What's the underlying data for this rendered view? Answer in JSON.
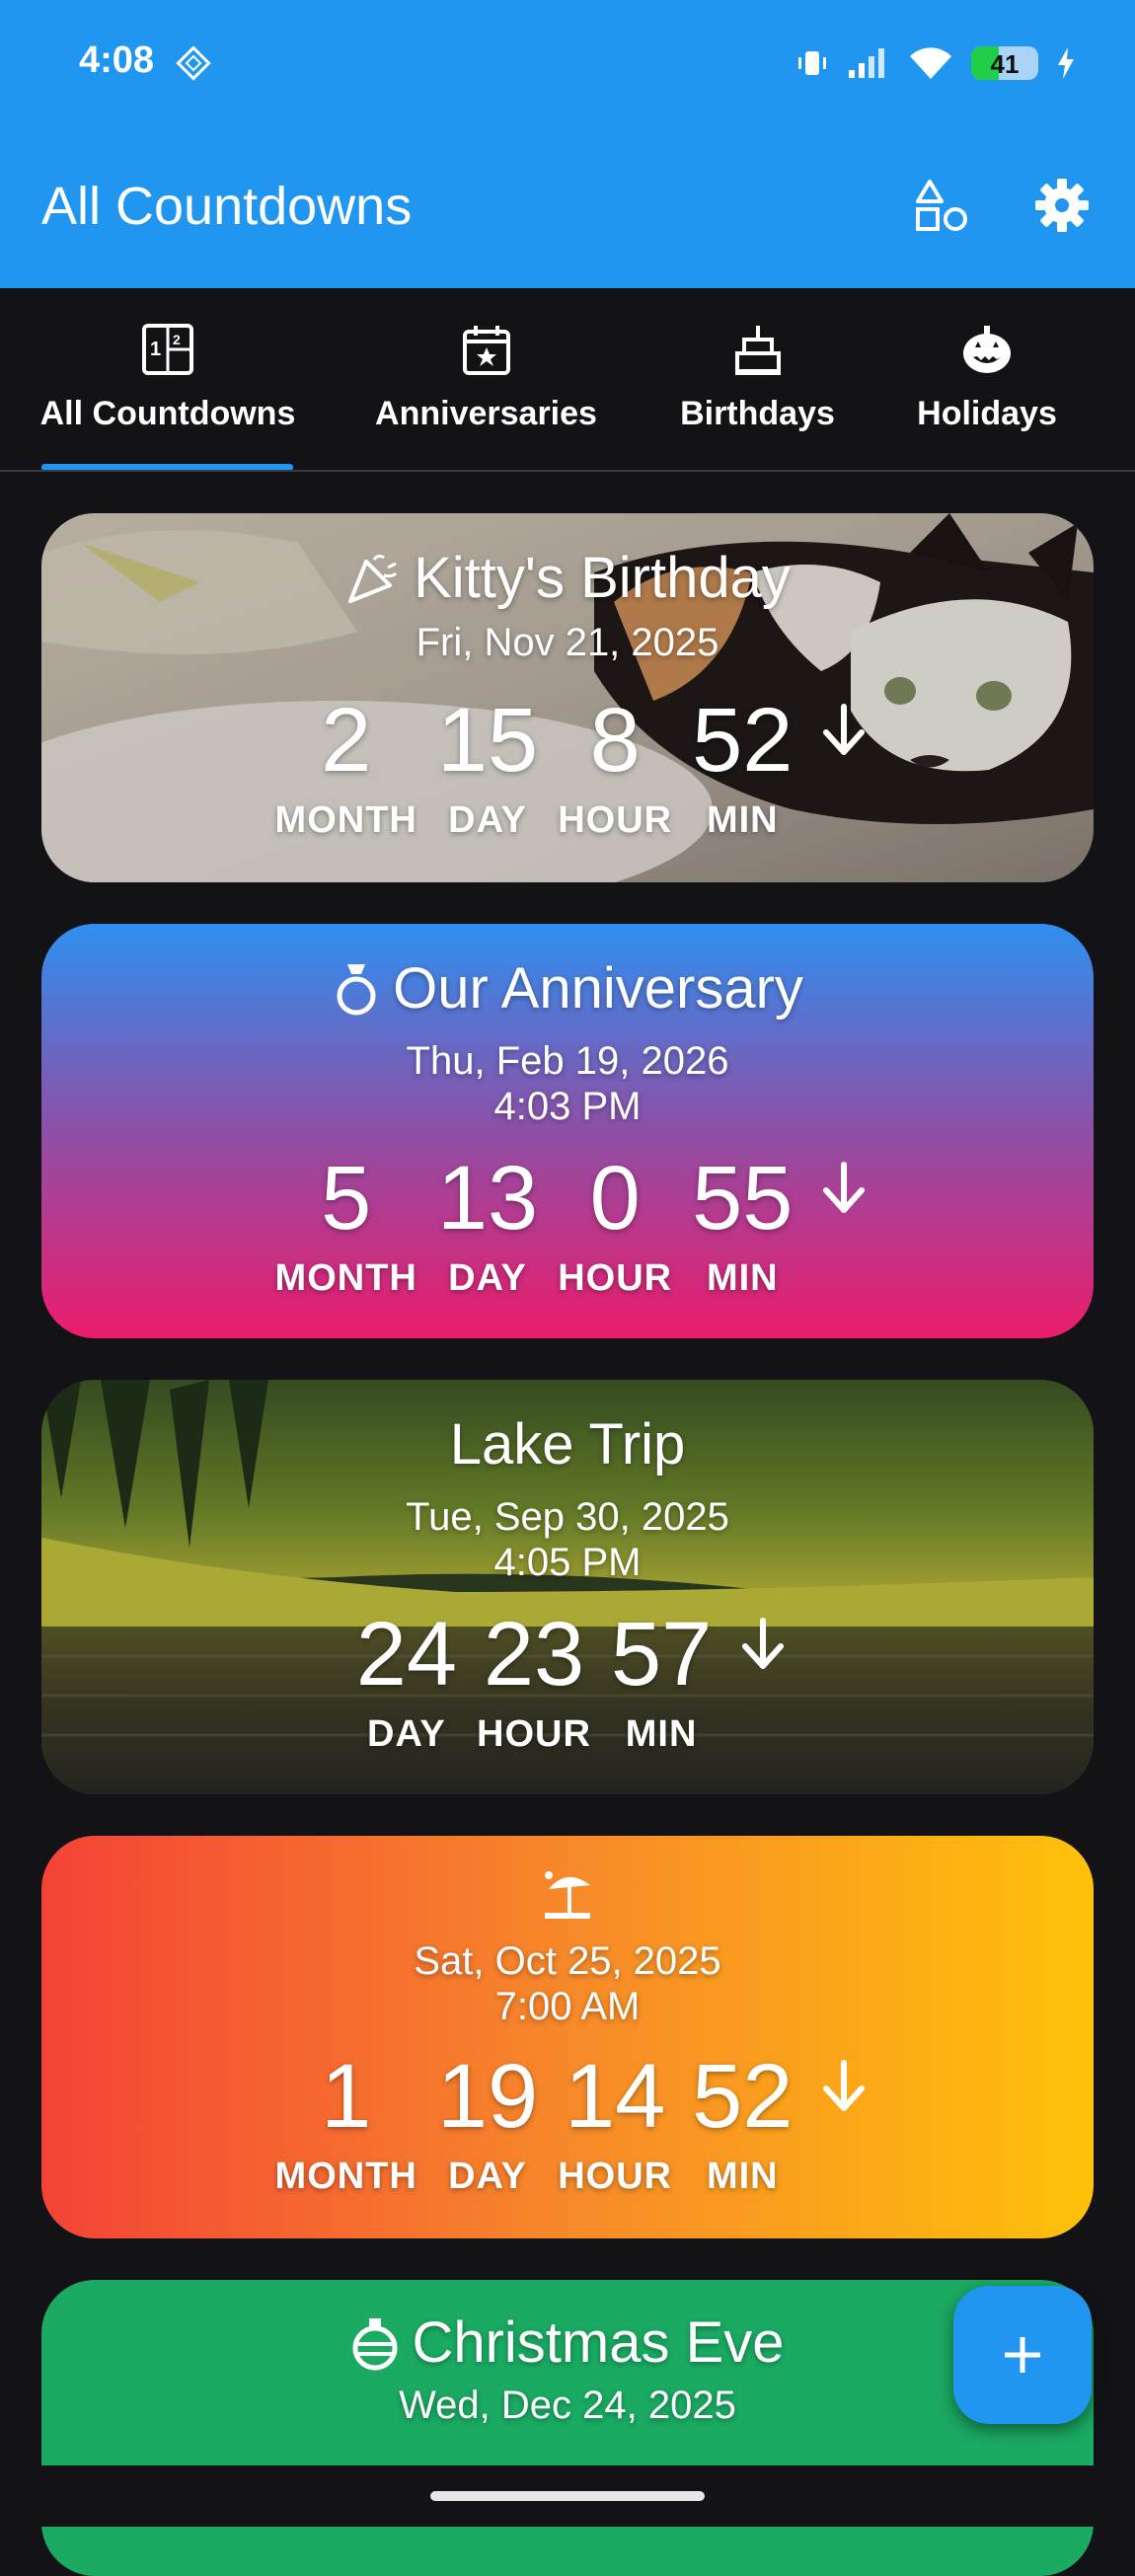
{
  "status": {
    "time": "4:08",
    "battery": "41",
    "battery_level": 0.41
  },
  "appbar": {
    "title": "All Countdowns"
  },
  "tabs": [
    {
      "label": "All Countdowns",
      "icon": "calendar-grid-icon",
      "selected": true
    },
    {
      "label": "Anniversaries",
      "icon": "calendar-star-icon"
    },
    {
      "label": "Birthdays",
      "icon": "cake-icon"
    },
    {
      "label": "Holidays",
      "icon": "pumpkin-icon"
    }
  ],
  "cards": [
    {
      "title": "Kitty's Birthday",
      "icon": "party-popper-icon",
      "date": "Fri, Nov 21, 2025",
      "units": [
        {
          "n": "2",
          "l": "MONTH"
        },
        {
          "n": "15",
          "l": "DAY"
        },
        {
          "n": "8",
          "l": "HOUR"
        },
        {
          "n": "52",
          "l": "MIN"
        }
      ]
    },
    {
      "title": "Our Anniversary",
      "icon": "ring-icon",
      "date": "Thu, Feb 19, 2026",
      "time": "4:03 PM",
      "units": [
        {
          "n": "5",
          "l": "MONTH"
        },
        {
          "n": "13",
          "l": "DAY"
        },
        {
          "n": "0",
          "l": "HOUR"
        },
        {
          "n": "55",
          "l": "MIN"
        }
      ]
    },
    {
      "title": "Lake Trip",
      "date": "Tue, Sep 30, 2025",
      "time": "4:05 PM",
      "units": [
        {
          "n": "24",
          "l": "DAY"
        },
        {
          "n": "23",
          "l": "HOUR"
        },
        {
          "n": "57",
          "l": "MIN"
        }
      ]
    },
    {
      "icon": "beach-umbrella-icon",
      "date": "Sat, Oct 25, 2025",
      "time": "7:00 AM",
      "units": [
        {
          "n": "1",
          "l": "MONTH"
        },
        {
          "n": "19",
          "l": "DAY"
        },
        {
          "n": "14",
          "l": "HOUR"
        },
        {
          "n": "52",
          "l": "MIN"
        }
      ]
    },
    {
      "title": "Christmas Eve",
      "icon": "ornament-icon",
      "date": "Wed, Dec 24, 2025"
    }
  ],
  "fab": {
    "icon": "plus-icon"
  },
  "colors": {
    "primary": "#2196f0",
    "background": "#131217"
  }
}
